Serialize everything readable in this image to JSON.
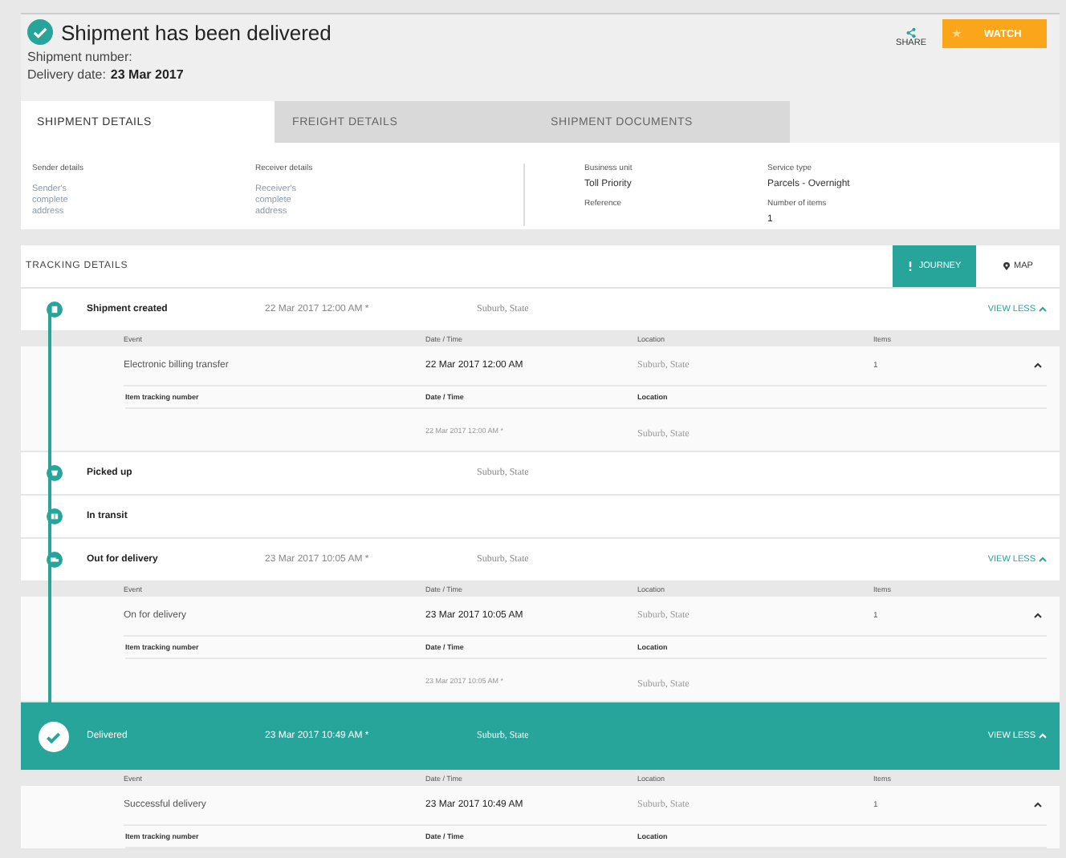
{
  "header": {
    "title": "Shipment has been delivered",
    "shipment_number_label": "Shipment number:",
    "delivery_date_label": "Delivery date:",
    "delivery_date": "23 Mar 2017",
    "share": "SHARE",
    "watch": "WATCH",
    "watch_icon": "★"
  },
  "tabs": [
    {
      "label": "SHIPMENT DETAILS",
      "selected": true
    },
    {
      "label": "FREIGHT DETAILS",
      "selected": false
    },
    {
      "label": "SHIPMENT DOCUMENTS",
      "selected": false
    }
  ],
  "details": {
    "left": [
      {
        "label": "Sender details",
        "value": "Sender's complete address"
      },
      {
        "label": "Receiver details",
        "value": "Receiver's complete address"
      }
    ],
    "right": [
      {
        "label": "Business unit",
        "value": "Toll Priority"
      },
      {
        "label": "Service type",
        "value": "Parcels - Overnight"
      },
      {
        "label": "Reference"
      },
      {
        "label": "Number of items",
        "value": "1"
      }
    ]
  },
  "tracking": {
    "title": "TRACKING DETAILS",
    "views": [
      {
        "label": "JOURNEY",
        "selected": true,
        "kind": "journey"
      },
      {
        "label": "MAP",
        "selected": false,
        "kind": "map"
      }
    ],
    "milestones": [
      {
        "kind": "created",
        "label": "Shipment created",
        "date": "22 Mar 2017 12:00 AM *",
        "location": "Suburb, State",
        "selected": false,
        "expanded": true,
        "toggle": "VIEW LESS",
        "columns": [
          "Event",
          "Date / Time",
          "Location",
          "Items"
        ],
        "events": [
          {
            "event": "Electronic billing transfer",
            "date": "22 Mar 2017 12:00 AM",
            "location": "Suburb, State",
            "items": "1",
            "expanded": true,
            "item_columns": [
              "Item tracking number",
              "Date / Time",
              "Location"
            ],
            "item_rows": [
              {
                "date": "22 Mar 2017 12:00 AM *",
                "location": "Suburb, State"
              }
            ]
          }
        ]
      },
      {
        "kind": "picked",
        "label": "Picked up",
        "location": "Suburb, State",
        "selected": false,
        "expanded": false
      },
      {
        "kind": "transit",
        "label": "In transit",
        "selected": false,
        "expanded": false
      },
      {
        "kind": "out",
        "label": "Out for delivery",
        "date": "23 Mar 2017 10:05 AM *",
        "location": "Suburb, State",
        "selected": false,
        "expanded": true,
        "toggle": "VIEW LESS",
        "columns": [
          "Event",
          "Date / Time",
          "Location",
          "Items"
        ],
        "events": [
          {
            "event": "On for delivery",
            "date": "23 Mar 2017 10:05 AM",
            "location": "Suburb, State",
            "items": "1",
            "expanded": true,
            "item_columns": [
              "Item tracking number",
              "Date / Time",
              "Location"
            ],
            "item_rows": [
              {
                "date": "23 Mar 2017 10:05 AM *",
                "location": "Suburb, State"
              }
            ]
          }
        ]
      },
      {
        "kind": "delivered",
        "label": "Delivered",
        "date": "23 Mar 2017 10:49 AM *",
        "location": "Suburb, State",
        "selected": true,
        "expanded": true,
        "toggle": "VIEW LESS",
        "columns": [
          "Event",
          "Date / Time",
          "Location",
          "Items"
        ],
        "events": [
          {
            "event": "Successful delivery",
            "date": "23 Mar 2017 10:49 AM",
            "location": "Suburb, State",
            "items": "1",
            "expanded": true,
            "item_columns": [
              "Item tracking number",
              "Date / Time",
              "Location"
            ]
          }
        ]
      }
    ]
  }
}
